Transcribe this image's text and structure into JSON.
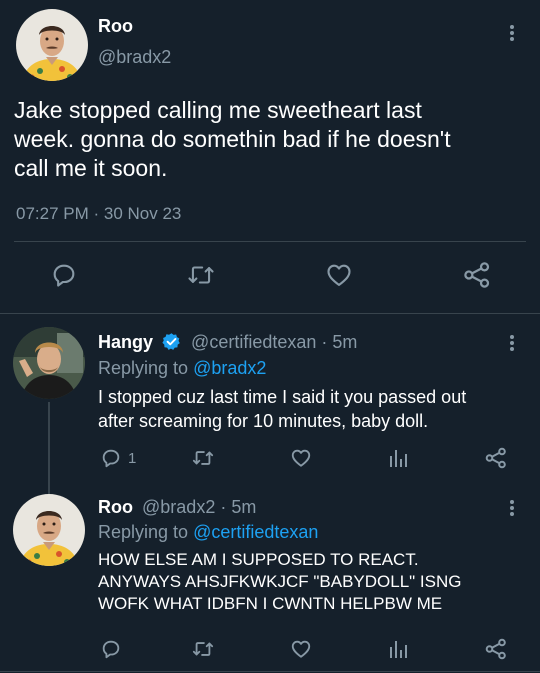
{
  "main_tweet": {
    "display_name": "Roo",
    "handle": "@bradx2",
    "text_lines": [
      "Jake stopped calling me sweetheart last",
      "week. gonna do somethin bad if he doesn't",
      "call me it soon."
    ],
    "timestamp": "07:27 PM · 30 Nov 23"
  },
  "replies": [
    {
      "display_name": "Hangy",
      "handle": "@certifiedtexan",
      "time": "· 5m",
      "replying_prefix": "Replying to",
      "replying_to": "@bradx2",
      "text_lines": [
        "I stopped cuz last time I said it you passed out",
        "after screaming for 10 minutes, baby doll."
      ],
      "reply_count": "1",
      "verified": true
    },
    {
      "display_name": "Roo",
      "handle": "@bradx2",
      "time": "· 5m",
      "replying_prefix": "Replying to",
      "replying_to": "@certifiedtexan",
      "text_lines": [
        "HOW ELSE AM I SUPPOSED TO REACT.",
        "ANYWAYS AHSJFKWKJCF \"BABYDOLL\" ISNG",
        "WOFK WHAT IDBFN I CWNTN HELPBW ME"
      ]
    }
  ],
  "icons": {
    "reply": "reply-icon",
    "retweet": "retweet-icon",
    "like": "heart-icon",
    "share": "share-icon",
    "analytics": "analytics-icon",
    "more": "more-vertical-icon",
    "verified": "verified-badge-icon"
  },
  "colors": {
    "background": "#15202b",
    "text": "#ffffff",
    "muted": "#8899a6",
    "accent": "#1da1f2",
    "divider": "#38444d"
  }
}
